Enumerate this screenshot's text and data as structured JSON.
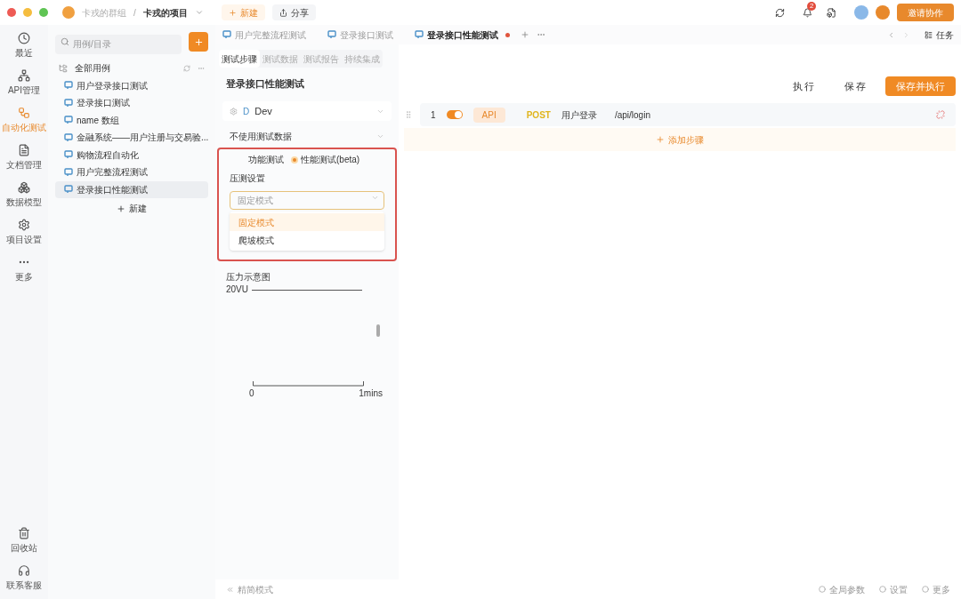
{
  "titlebar": {
    "breadcrumb": [
      "卡戎的群组",
      "/",
      "卡戎的项目"
    ],
    "new_button": "新建",
    "share_button": "分享",
    "notification_count": "2",
    "invite_button": "邀请协作"
  },
  "rail": {
    "items": [
      {
        "label": "最近",
        "selected": false
      },
      {
        "label": "API管理",
        "selected": false
      },
      {
        "label": "自动化测试",
        "selected": true
      },
      {
        "label": "文档管理",
        "selected": false
      },
      {
        "label": "数据模型",
        "selected": false
      },
      {
        "label": "项目设置",
        "selected": false
      },
      {
        "label": "更多",
        "selected": false
      }
    ],
    "bottom_items": [
      {
        "label": "回收站"
      },
      {
        "label": "联系客服"
      }
    ]
  },
  "sidebar": {
    "search": {
      "placeholder": "用例/目录"
    },
    "root": "全部用例",
    "items": [
      {
        "label": "用户登录接口测试",
        "selected": false
      },
      {
        "label": "登录接口测试",
        "selected": false
      },
      {
        "label": "name 数组",
        "selected": false
      },
      {
        "label": "金融系统——用户注册与交易验...",
        "selected": false
      },
      {
        "label": "购物流程自动化",
        "selected": false
      },
      {
        "label": "用户完整流程测试",
        "selected": false
      },
      {
        "label": "登录接口性能测试",
        "selected": true
      }
    ],
    "new_button": "新建"
  },
  "doc_tabs": [
    {
      "label": "用户完整流程测试",
      "selected": false,
      "modified": false
    },
    {
      "label": "登录接口测试",
      "selected": false,
      "modified": false
    },
    {
      "label": "登录接口性能测试",
      "selected": true,
      "modified": true
    }
  ],
  "tasks_button": "任务",
  "sub_tabs": [
    {
      "label": "测试步骤",
      "selected": true
    },
    {
      "label": "测试数据",
      "selected": false
    },
    {
      "label": "测试报告",
      "selected": false
    },
    {
      "label": "持续集成",
      "selected": false
    }
  ],
  "title": "登录接口性能测试",
  "actions": [
    "执行",
    "保存"
  ],
  "primary_action": "保存并执行",
  "config": {
    "environment_badge": "D",
    "environment": "Dev",
    "data_select": "不使用测试数据",
    "modes": [
      {
        "label": "功能测试",
        "selected": false
      },
      {
        "label": "性能测试(beta)",
        "selected": true
      }
    ],
    "load_label": "压测设置",
    "load_select": {
      "placeholder": "固定模式"
    },
    "load_options": [
      {
        "label": "固定模式",
        "selected": true
      },
      {
        "label": "爬坡模式",
        "selected": false
      }
    ],
    "chart_title": "压力示意图",
    "chart_y_label": "20VU",
    "chart_x_start": "0",
    "chart_x_end": "1mins"
  },
  "steps": [
    {
      "index": "1",
      "on": true,
      "tag": "API",
      "method": "POST",
      "name": "用户登录",
      "path": "/api/login"
    }
  ],
  "add_step": "添加步骤",
  "footer": {
    "left": "精简模式",
    "items": [
      "全局参数",
      "设置",
      "更多"
    ]
  }
}
